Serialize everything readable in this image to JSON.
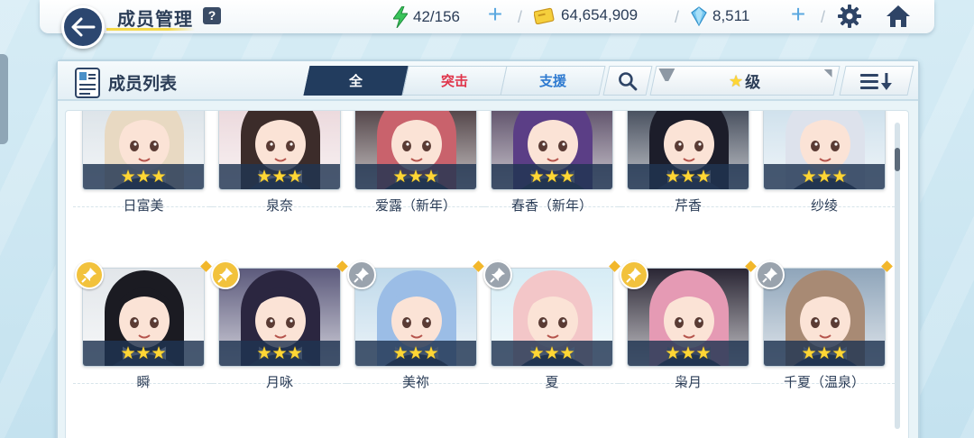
{
  "topbar": {
    "title": "成员管理",
    "help": "?",
    "ap": "42/156",
    "credits": "64,654,909",
    "gems": "8,511",
    "separator": "/"
  },
  "panel": {
    "title": "成员列表",
    "tabs": [
      {
        "label": "全",
        "active": true
      },
      {
        "label": "突击",
        "active": false
      },
      {
        "label": "支援",
        "active": false
      }
    ],
    "filter_label": "级",
    "filter_star": "★"
  },
  "students": [
    {
      "name": "日富美",
      "stars": "★★★",
      "pinned": null,
      "bg": "#d8e0e6",
      "hair": "#e8d9c2"
    },
    {
      "name": "泉奈",
      "stars": "★★★",
      "pinned": null,
      "bg": "#e9d4d8",
      "hair": "#3c2c2a"
    },
    {
      "name": "爱露（新年）",
      "stars": "★★★",
      "pinned": null,
      "bg": "#3a2a2e",
      "hair": "#c9626c"
    },
    {
      "name": "春香（新年）",
      "stars": "★★★",
      "pinned": null,
      "bg": "#4a3b57",
      "hair": "#5b3e86"
    },
    {
      "name": "芹香",
      "stars": "★★★",
      "pinned": null,
      "bg": "#2d3647",
      "hair": "#1c1d2a"
    },
    {
      "name": "纱绫",
      "stars": "★★★",
      "pinned": null,
      "bg": "#c9ddea",
      "hair": "#dde2ec"
    },
    {
      "name": "瞬",
      "stars": "★★★",
      "pinned": "gold",
      "bg": "#e2e6ea",
      "hair": "#1b1b22"
    },
    {
      "name": "月咏",
      "stars": "★★★",
      "pinned": "gold",
      "bg": "#5c5a7c",
      "hair": "#2b2640"
    },
    {
      "name": "美祢",
      "stars": "★★★",
      "pinned": "grey",
      "bg": "#bfd9ea",
      "hair": "#9bbde6"
    },
    {
      "name": "夏",
      "stars": "★★★",
      "pinned": "grey",
      "bg": "#d6ecf5",
      "hair": "#f3c6c8"
    },
    {
      "name": "枭月",
      "stars": "★★★",
      "pinned": "gold",
      "bg": "#2a2634",
      "hair": "#e59ab4"
    },
    {
      "name": "千夏（温泉）",
      "stars": "★★★",
      "pinned": "grey",
      "bg": "#8fa5ba",
      "hair": "#a88a74"
    }
  ],
  "colors": {
    "accent_dark": "#223c5e",
    "assault": "#e0344a",
    "support": "#2e7ad0",
    "star": "#ffd635",
    "pin_gold": "#f2c23c",
    "pin_grey": "#9aa3ad"
  }
}
